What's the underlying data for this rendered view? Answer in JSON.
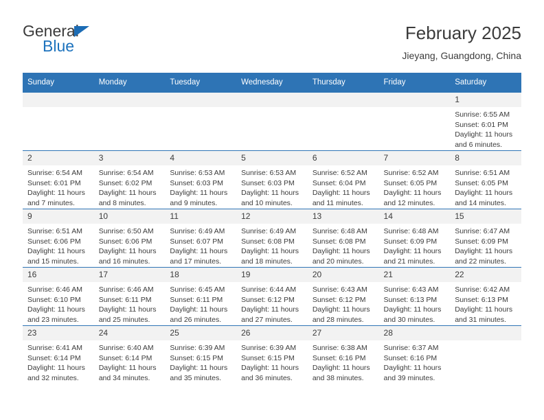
{
  "logo": {
    "word1": "General",
    "word2": "Blue",
    "triangle_color": "#1c6cb5",
    "blue_color": "#1c72bd"
  },
  "header": {
    "title": "February 2025",
    "location": "Jieyang, Guangdong, China"
  },
  "theme": {
    "header_blue": "#2e74b5",
    "daynum_gray": "#f2f2f2",
    "text": "#3b3b3b"
  },
  "calendar": {
    "weekday_headers": [
      "Sunday",
      "Monday",
      "Tuesday",
      "Wednesday",
      "Thursday",
      "Friday",
      "Saturday"
    ],
    "labels": {
      "sunrise": "Sunrise:",
      "sunset": "Sunset:",
      "daylight": "Daylight:"
    },
    "weeks": [
      [
        {
          "day": "",
          "empty": true
        },
        {
          "day": "",
          "empty": true
        },
        {
          "day": "",
          "empty": true
        },
        {
          "day": "",
          "empty": true
        },
        {
          "day": "",
          "empty": true
        },
        {
          "day": "",
          "empty": true
        },
        {
          "day": "1",
          "sunrise": "Sunrise: 6:55 AM",
          "sunset": "Sunset: 6:01 PM",
          "daylight": "Daylight: 11 hours and 6 minutes."
        }
      ],
      [
        {
          "day": "2",
          "sunrise": "Sunrise: 6:54 AM",
          "sunset": "Sunset: 6:01 PM",
          "daylight": "Daylight: 11 hours and 7 minutes."
        },
        {
          "day": "3",
          "sunrise": "Sunrise: 6:54 AM",
          "sunset": "Sunset: 6:02 PM",
          "daylight": "Daylight: 11 hours and 8 minutes."
        },
        {
          "day": "4",
          "sunrise": "Sunrise: 6:53 AM",
          "sunset": "Sunset: 6:03 PM",
          "daylight": "Daylight: 11 hours and 9 minutes."
        },
        {
          "day": "5",
          "sunrise": "Sunrise: 6:53 AM",
          "sunset": "Sunset: 6:03 PM",
          "daylight": "Daylight: 11 hours and 10 minutes."
        },
        {
          "day": "6",
          "sunrise": "Sunrise: 6:52 AM",
          "sunset": "Sunset: 6:04 PM",
          "daylight": "Daylight: 11 hours and 11 minutes."
        },
        {
          "day": "7",
          "sunrise": "Sunrise: 6:52 AM",
          "sunset": "Sunset: 6:05 PM",
          "daylight": "Daylight: 11 hours and 12 minutes."
        },
        {
          "day": "8",
          "sunrise": "Sunrise: 6:51 AM",
          "sunset": "Sunset: 6:05 PM",
          "daylight": "Daylight: 11 hours and 14 minutes."
        }
      ],
      [
        {
          "day": "9",
          "sunrise": "Sunrise: 6:51 AM",
          "sunset": "Sunset: 6:06 PM",
          "daylight": "Daylight: 11 hours and 15 minutes."
        },
        {
          "day": "10",
          "sunrise": "Sunrise: 6:50 AM",
          "sunset": "Sunset: 6:06 PM",
          "daylight": "Daylight: 11 hours and 16 minutes."
        },
        {
          "day": "11",
          "sunrise": "Sunrise: 6:49 AM",
          "sunset": "Sunset: 6:07 PM",
          "daylight": "Daylight: 11 hours and 17 minutes."
        },
        {
          "day": "12",
          "sunrise": "Sunrise: 6:49 AM",
          "sunset": "Sunset: 6:08 PM",
          "daylight": "Daylight: 11 hours and 18 minutes."
        },
        {
          "day": "13",
          "sunrise": "Sunrise: 6:48 AM",
          "sunset": "Sunset: 6:08 PM",
          "daylight": "Daylight: 11 hours and 20 minutes."
        },
        {
          "day": "14",
          "sunrise": "Sunrise: 6:48 AM",
          "sunset": "Sunset: 6:09 PM",
          "daylight": "Daylight: 11 hours and 21 minutes."
        },
        {
          "day": "15",
          "sunrise": "Sunrise: 6:47 AM",
          "sunset": "Sunset: 6:09 PM",
          "daylight": "Daylight: 11 hours and 22 minutes."
        }
      ],
      [
        {
          "day": "16",
          "sunrise": "Sunrise: 6:46 AM",
          "sunset": "Sunset: 6:10 PM",
          "daylight": "Daylight: 11 hours and 23 minutes."
        },
        {
          "day": "17",
          "sunrise": "Sunrise: 6:46 AM",
          "sunset": "Sunset: 6:11 PM",
          "daylight": "Daylight: 11 hours and 25 minutes."
        },
        {
          "day": "18",
          "sunrise": "Sunrise: 6:45 AM",
          "sunset": "Sunset: 6:11 PM",
          "daylight": "Daylight: 11 hours and 26 minutes."
        },
        {
          "day": "19",
          "sunrise": "Sunrise: 6:44 AM",
          "sunset": "Sunset: 6:12 PM",
          "daylight": "Daylight: 11 hours and 27 minutes."
        },
        {
          "day": "20",
          "sunrise": "Sunrise: 6:43 AM",
          "sunset": "Sunset: 6:12 PM",
          "daylight": "Daylight: 11 hours and 28 minutes."
        },
        {
          "day": "21",
          "sunrise": "Sunrise: 6:43 AM",
          "sunset": "Sunset: 6:13 PM",
          "daylight": "Daylight: 11 hours and 30 minutes."
        },
        {
          "day": "22",
          "sunrise": "Sunrise: 6:42 AM",
          "sunset": "Sunset: 6:13 PM",
          "daylight": "Daylight: 11 hours and 31 minutes."
        }
      ],
      [
        {
          "day": "23",
          "sunrise": "Sunrise: 6:41 AM",
          "sunset": "Sunset: 6:14 PM",
          "daylight": "Daylight: 11 hours and 32 minutes."
        },
        {
          "day": "24",
          "sunrise": "Sunrise: 6:40 AM",
          "sunset": "Sunset: 6:14 PM",
          "daylight": "Daylight: 11 hours and 34 minutes."
        },
        {
          "day": "25",
          "sunrise": "Sunrise: 6:39 AM",
          "sunset": "Sunset: 6:15 PM",
          "daylight": "Daylight: 11 hours and 35 minutes."
        },
        {
          "day": "26",
          "sunrise": "Sunrise: 6:39 AM",
          "sunset": "Sunset: 6:15 PM",
          "daylight": "Daylight: 11 hours and 36 minutes."
        },
        {
          "day": "27",
          "sunrise": "Sunrise: 6:38 AM",
          "sunset": "Sunset: 6:16 PM",
          "daylight": "Daylight: 11 hours and 38 minutes."
        },
        {
          "day": "28",
          "sunrise": "Sunrise: 6:37 AM",
          "sunset": "Sunset: 6:16 PM",
          "daylight": "Daylight: 11 hours and 39 minutes."
        },
        {
          "day": "",
          "empty": true
        }
      ]
    ]
  }
}
